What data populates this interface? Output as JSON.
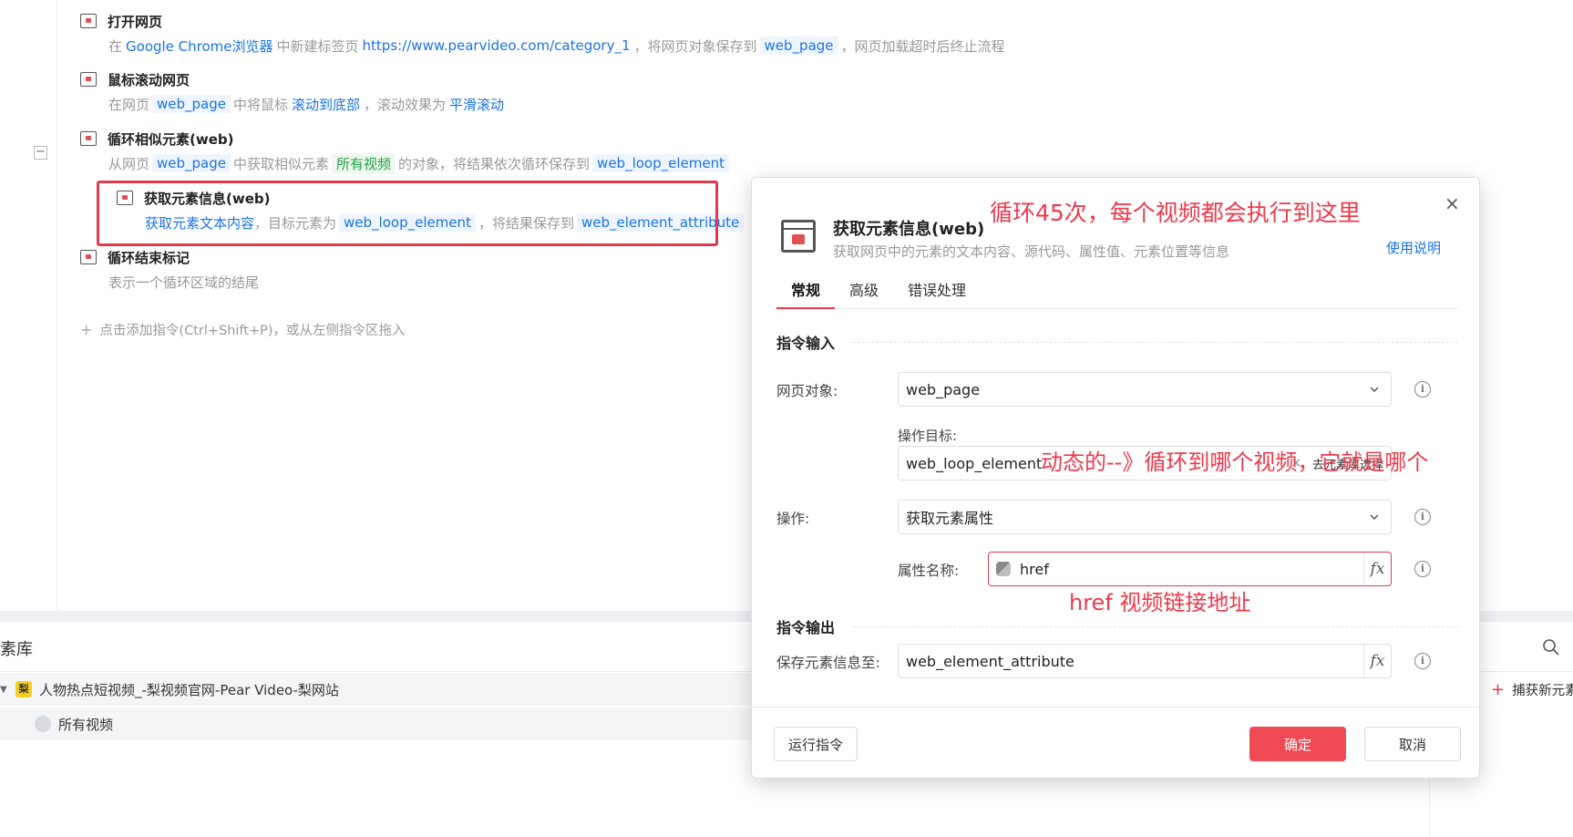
{
  "steps": [
    {
      "title": "打开网页",
      "parts": [
        {
          "t": "text",
          "v": "在"
        },
        {
          "t": "link",
          "v": "Google Chrome浏览器"
        },
        {
          "t": "text",
          "v": "中新建标签页"
        },
        {
          "t": "link",
          "v": "https://www.pearvideo.com/category_1"
        },
        {
          "t": "text",
          "v": "，将网页对象保存到"
        },
        {
          "t": "var",
          "v": "web_page"
        },
        {
          "t": "text",
          "v": "，网页加载超时后终止流程"
        }
      ]
    },
    {
      "title": "鼠标滚动网页",
      "parts": [
        {
          "t": "text",
          "v": "在网页"
        },
        {
          "t": "var",
          "v": "web_page"
        },
        {
          "t": "text",
          "v": "中将鼠标"
        },
        {
          "t": "link",
          "v": "滚动到底部"
        },
        {
          "t": "text",
          "v": "，滚动效果为"
        },
        {
          "t": "link",
          "v": "平滑滚动"
        }
      ]
    },
    {
      "title": "循环相似元素(web)",
      "parts": [
        {
          "t": "text",
          "v": "从网页"
        },
        {
          "t": "var",
          "v": "web_page"
        },
        {
          "t": "text",
          "v": "中获取相似元素"
        },
        {
          "t": "green",
          "v": "所有视频"
        },
        {
          "t": "text",
          "v": "的对象，将结果依次循环保存到"
        },
        {
          "t": "var",
          "v": "web_loop_element"
        }
      ]
    },
    {
      "title": "获取元素信息(web)",
      "parts": [
        {
          "t": "link",
          "v": "获取元素文本内容"
        },
        {
          "t": "text",
          "v": "，目标元素为"
        },
        {
          "t": "var",
          "v": "web_loop_element"
        },
        {
          "t": "text",
          "v": "，将结果保存到"
        },
        {
          "t": "var",
          "v": "web_element_attribute"
        }
      ]
    },
    {
      "title": "循环结束标记",
      "parts": [
        {
          "t": "text",
          "v": "表示一个循环区域的结尾"
        }
      ]
    }
  ],
  "add_hint": "点击添加指令(Ctrl+Shift+P)，或从左侧指令区拖入",
  "collapse_symbol": "−",
  "bottom": {
    "lib_title": "素库",
    "tree": [
      {
        "label": "人物热点短视频_-梨视频官网-Pear Video-梨网站",
        "icon_text": "梨"
      },
      {
        "label": "所有视频"
      }
    ],
    "capture_label": "捕获新元素"
  },
  "dialog": {
    "title": "获取元素信息(web)",
    "subtitle": "获取网页中的元素的文本内容、源代码、属性值、元素位置等信息",
    "help": "使用说明",
    "close": "×",
    "tabs": [
      "常规",
      "高级",
      "错误处理"
    ],
    "section_input": "指令输入",
    "section_output": "指令输出",
    "web_object_label": "网页对象:",
    "web_object_value": "web_page",
    "target_label": "操作目标:",
    "target_value": "web_loop_element",
    "target_clear": "×",
    "target_pick": "去元素库选择",
    "op_label": "操作:",
    "op_value": "获取元素属性",
    "attr_label": "属性名称:",
    "attr_value": "href",
    "save_label": "保存元素信息至:",
    "save_value": "web_element_attribute",
    "fx": "fx",
    "info": "i",
    "run_button": "运行指令",
    "ok_button": "确定",
    "cancel_button": "取消"
  },
  "annotations": {
    "loop_note": "循环45次，每个视频都会执行到这里",
    "dynamic_note": "动态的--》循环到哪个视频，它就是哪个",
    "href_note": "href 视频链接地址"
  },
  "colors": {
    "accent_red": "#e8384c",
    "link_blue": "#1a73e8",
    "green": "#22a045",
    "primary_button": "#f04a55"
  }
}
